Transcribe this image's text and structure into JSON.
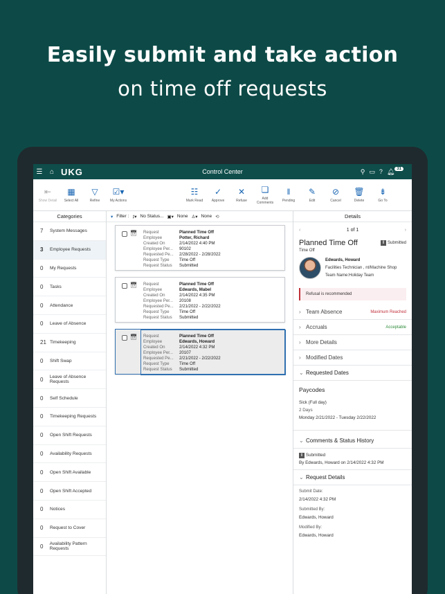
{
  "hero": {
    "line1": "Easily submit and take action",
    "line2": "on time off requests"
  },
  "topbar": {
    "logo": "UKG",
    "title": "Control Center",
    "notif_count": "31"
  },
  "toolbar": {
    "left": [
      {
        "label": "Show Detail",
        "icon": "show-detail-icon",
        "glyph": "⇤",
        "disabled": true
      },
      {
        "label": "Select All",
        "icon": "select-all-icon",
        "glyph": "▦",
        "disabled": false
      },
      {
        "label": "Refine",
        "icon": "refine-icon",
        "glyph": "▽",
        "disabled": false
      },
      {
        "label": "My Actions",
        "icon": "my-actions-icon",
        "glyph": "☑▾",
        "disabled": false
      }
    ],
    "right": [
      {
        "label": "Mark Read",
        "icon": "mark-read-icon",
        "glyph": "☷"
      },
      {
        "label": "Approve",
        "icon": "approve-icon",
        "glyph": "✓"
      },
      {
        "label": "Refuse",
        "icon": "refuse-icon",
        "glyph": "✕"
      },
      {
        "label": "Add Comments",
        "icon": "add-comments-icon",
        "glyph": "❏"
      },
      {
        "label": "Pending",
        "icon": "pending-icon",
        "glyph": "‖"
      },
      {
        "label": "Edit",
        "icon": "edit-icon",
        "glyph": "✎"
      },
      {
        "label": "Cancel",
        "icon": "cancel-icon",
        "glyph": "⊘"
      },
      {
        "label": "Delete",
        "icon": "delete-icon",
        "glyph": "🗑"
      },
      {
        "label": "Go To",
        "icon": "go-to-icon",
        "glyph": "⇟"
      }
    ]
  },
  "categories": {
    "header": "Categories",
    "items": [
      {
        "count": "7",
        "label": "System Messages"
      },
      {
        "count": "3",
        "label": "Employee Requests",
        "selected": true
      },
      {
        "count": "0",
        "label": "My Requests"
      },
      {
        "count": "0",
        "label": "Tasks"
      },
      {
        "count": "0",
        "label": "Attendance"
      },
      {
        "count": "0",
        "label": "Leave of Absence"
      },
      {
        "count": "21",
        "label": "Timekeeping"
      },
      {
        "count": "0",
        "label": "Shift Swap"
      },
      {
        "count": "0",
        "label": "Leave of Absence Requests"
      },
      {
        "count": "0",
        "label": "Self Schedule"
      },
      {
        "count": "0",
        "label": "Timekeeping Requests"
      },
      {
        "count": "0",
        "label": "Open Shift Requests"
      },
      {
        "count": "0",
        "label": "Availability Requests"
      },
      {
        "count": "0",
        "label": "Open Shift Available"
      },
      {
        "count": "0",
        "label": "Open Shift Accepted"
      },
      {
        "count": "0",
        "label": "Notices"
      },
      {
        "count": "0",
        "label": "Request to Cover"
      },
      {
        "count": "0",
        "label": "Availability Pattern Requests"
      }
    ]
  },
  "filter": {
    "label": "Filter :",
    "status": "No Status...",
    "date": "None",
    "people": "None"
  },
  "cards": [
    {
      "rows": [
        [
          "Request",
          "Planned Time Off"
        ],
        [
          "Employee",
          "Potter, Richard"
        ],
        [
          "Created On",
          "2/14/2022 4:40 PM"
        ],
        [
          "Employee Per...",
          "90102"
        ],
        [
          "Requested Pe...",
          "2/28/2022 - 2/28/2022"
        ],
        [
          "Request Type",
          "Time Off"
        ],
        [
          "Request Status",
          "Submitted"
        ]
      ]
    },
    {
      "rows": [
        [
          "Request",
          "Planned Time Off"
        ],
        [
          "Employee",
          "Edwards, Mabel"
        ],
        [
          "Created On",
          "2/14/2022 4:35 PM"
        ],
        [
          "Employee Per...",
          "20108"
        ],
        [
          "Requested Pe...",
          "2/21/2022 - 2/22/2022"
        ],
        [
          "Request Type",
          "Time Off"
        ],
        [
          "Request Status",
          "Submitted"
        ]
      ]
    },
    {
      "rows": [
        [
          "Request",
          "Planned Time Off"
        ],
        [
          "Employee",
          "Edwards, Howard"
        ],
        [
          "Created On",
          "2/14/2022 4:32 PM"
        ],
        [
          "Employee Per...",
          "20107"
        ],
        [
          "Requested Pe...",
          "2/21/2022 - 2/22/2022"
        ],
        [
          "Request Type",
          "Time Off"
        ],
        [
          "Request Status",
          "Submitted"
        ]
      ],
      "selected": true
    }
  ],
  "details": {
    "header": "Details",
    "pager": "1 of 1",
    "title": "Planned Time Off",
    "status": "Submitted",
    "subtitle": "Time Off",
    "person": {
      "name": "Edwards, Howard",
      "role": "Facilities Technician , nt/Machine Shop",
      "team": "Team Name:Holiday Team"
    },
    "warning": "Refusal is recommended",
    "sections": [
      {
        "label": "Team Absence",
        "tag": "Maximum Reached",
        "tag_color": "#c0303a"
      },
      {
        "label": "Accruals",
        "tag": "Acceptable",
        "tag_color": "#2e8b3a"
      },
      {
        "label": "More Details",
        "tag": ""
      },
      {
        "label": "Modified Dates",
        "tag": ""
      }
    ],
    "requested_dates": {
      "header": "Requested Dates",
      "paycodes": "Paycodes",
      "code": "Sick (Full day)",
      "days": "2 Days",
      "range": "Monday 2/21/2022 - Tuesday 2/22/2022"
    },
    "comments": {
      "header": "Comments & Status History",
      "status": "Submitted",
      "by": "By Edwards, Howard on 2/14/2022 4:32 PM"
    },
    "request_details": {
      "header": "Request Details",
      "submit_label": "Submit Date:",
      "submit_value": "2/14/2022 4:32 PM",
      "submitted_by_label": "Submitted By:",
      "submitted_by": "Edwards, Howard",
      "modified_by_label": "Modified By:",
      "modified_by": "Edwards, Howard"
    }
  }
}
